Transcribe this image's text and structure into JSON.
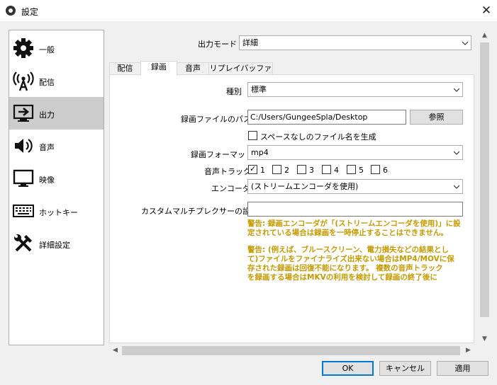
{
  "window": {
    "title": "設定",
    "close": "✕"
  },
  "sidebar": {
    "items": [
      {
        "label": "一般",
        "icon": "gear-icon"
      },
      {
        "label": "配信",
        "icon": "broadcast-icon"
      },
      {
        "label": "出力",
        "icon": "output-icon",
        "selected": true
      },
      {
        "label": "音声",
        "icon": "speaker-icon"
      },
      {
        "label": "映像",
        "icon": "monitor-icon"
      },
      {
        "label": "ホットキー",
        "icon": "keyboard-icon"
      },
      {
        "label": "詳細設定",
        "icon": "tools-icon"
      }
    ]
  },
  "output_mode": {
    "label": "出力モード",
    "value": "詳細"
  },
  "tabs": [
    {
      "label": "配信"
    },
    {
      "label": "録画",
      "active": true
    },
    {
      "label": "音声"
    },
    {
      "label": "リプレイバッファ"
    }
  ],
  "recording": {
    "type": {
      "label": "種別",
      "value": "標準"
    },
    "path": {
      "label": "録画ファイルのパス",
      "value": "C:/Users/GungeeSpla/Desktop",
      "browse": "参照"
    },
    "no_space": {
      "label": "スペースなしのファイル名を生成",
      "checked": false
    },
    "format": {
      "label": "録画フォーマット",
      "value": "mp4"
    },
    "audio_track": {
      "label": "音声トラック",
      "tracks": [
        {
          "label": "1",
          "checked": true
        },
        {
          "label": "2",
          "checked": false
        },
        {
          "label": "3",
          "checked": false
        },
        {
          "label": "4",
          "checked": false
        },
        {
          "label": "5",
          "checked": false
        },
        {
          "label": "6",
          "checked": false
        }
      ]
    },
    "encoder": {
      "label": "エンコーダ",
      "value": "(ストリームエンコーダを使用)"
    },
    "muxer": {
      "label": "カスタムマルチプレクサーの設定",
      "value": ""
    },
    "warning1": [
      "警告: 録画エンコーダが「(ストリームエンコーダを使用)」に設",
      "定されている場合は録画を一時停止することはできません。"
    ],
    "warning2": [
      "警告: (例えば、ブルースクリーン、電力損失などの結果とし",
      "て)ファイルをファイナライズ出来ない場合はMP4/MOVに保",
      "存された録画は回復不能になります。 複数の音声トラック",
      "を録画する場合はMKVの利用を検討して録画の終了後に"
    ],
    "warning_color": "#c59a00"
  },
  "buttons": {
    "ok": "OK",
    "cancel": "キャンセル",
    "apply": "適用"
  }
}
